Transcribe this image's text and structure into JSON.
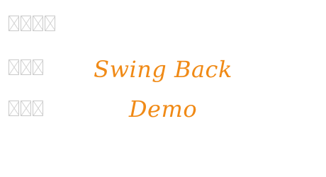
{
  "font_preview": {
    "text_line_1": "Swing Back",
    "text_line_2": "Demo",
    "text_color": "#f08a16"
  },
  "label_placeholders": {
    "row_1_glyph_count": 4,
    "row_2_glyph_count": 3,
    "row_3_glyph_count": 3,
    "glyph_style": "missing-glyph-box"
  }
}
